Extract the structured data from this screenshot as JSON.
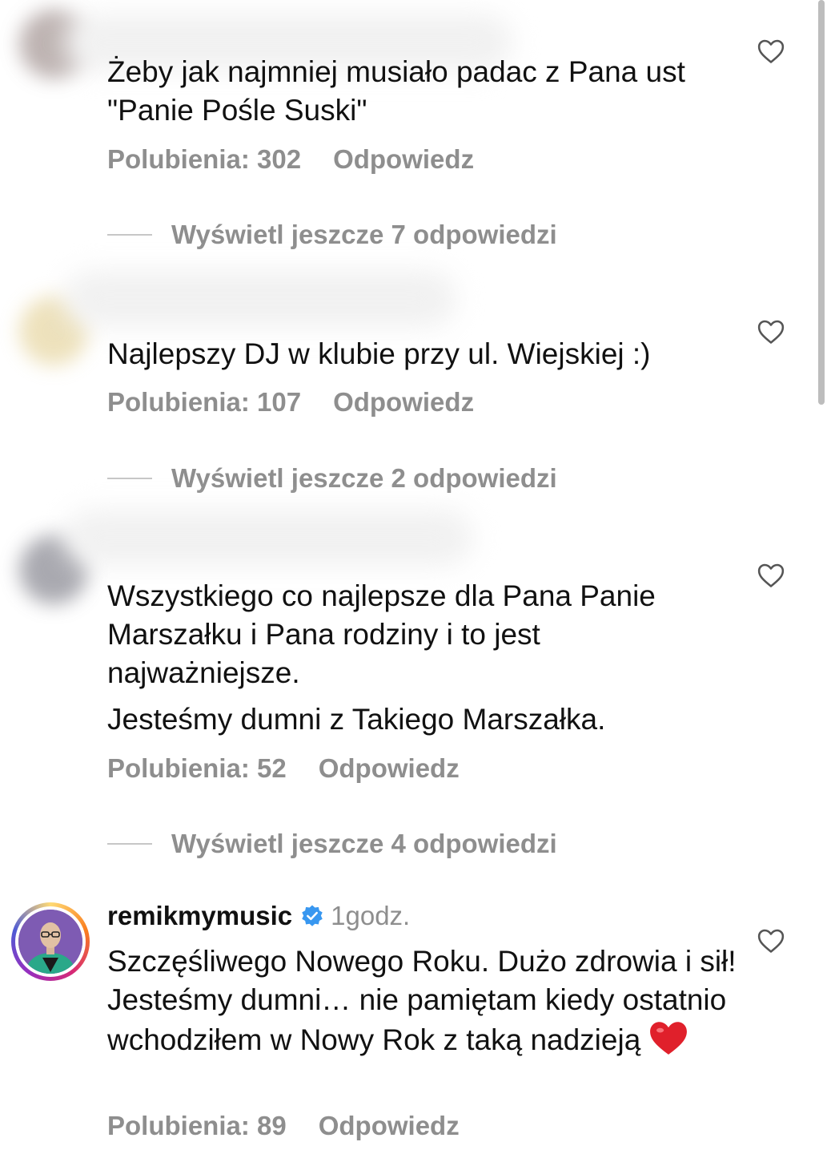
{
  "comments": [
    {
      "text_lines": [
        "Żeby jak najmniej musiało padac z Pana ust \"Panie Pośle Suski\""
      ],
      "likes_label": "Polubienia: 302",
      "reply_label": "Odpowiedz",
      "more_replies_label": "Wyświetl jeszcze 7 odpowiedzi"
    },
    {
      "text_lines": [
        "Najlepszy DJ w klubie przy ul. Wiejskiej :)"
      ],
      "likes_label": "Polubienia: 107",
      "reply_label": "Odpowiedz",
      "more_replies_label": "Wyświetl jeszcze 2 odpowiedzi"
    },
    {
      "text_lines": [
        "Wszystkiego co najlepsze dla Pana Panie Marszałku i Pana rodziny i to jest najważniejsze.",
        "Jesteśmy dumni z Takiego Marszałka."
      ],
      "likes_label": "Polubienia: 52",
      "reply_label": "Odpowiedz",
      "more_replies_label": "Wyświetl jeszcze 4 odpowiedzi"
    },
    {
      "username": "remikmymusic",
      "time": "1godz.",
      "text": "Szczęśliwego Nowego Roku. Dużo zdrowia i sił! Jesteśmy dumni… nie pamiętam kiedy ostatnio wchodziłem w Nowy Rok z taką nadzieją",
      "likes_label": "Polubienia: 89",
      "reply_label": "Odpowiedz"
    }
  ],
  "icons": {
    "like": "heart-outline-icon",
    "verified": "verified-badge-icon",
    "emoji": "red-heart-emoji"
  },
  "colors": {
    "text": "#111111",
    "secondary": "#8e8e8e",
    "verified": "#3897f0",
    "heart_emoji": "#e0202b"
  }
}
